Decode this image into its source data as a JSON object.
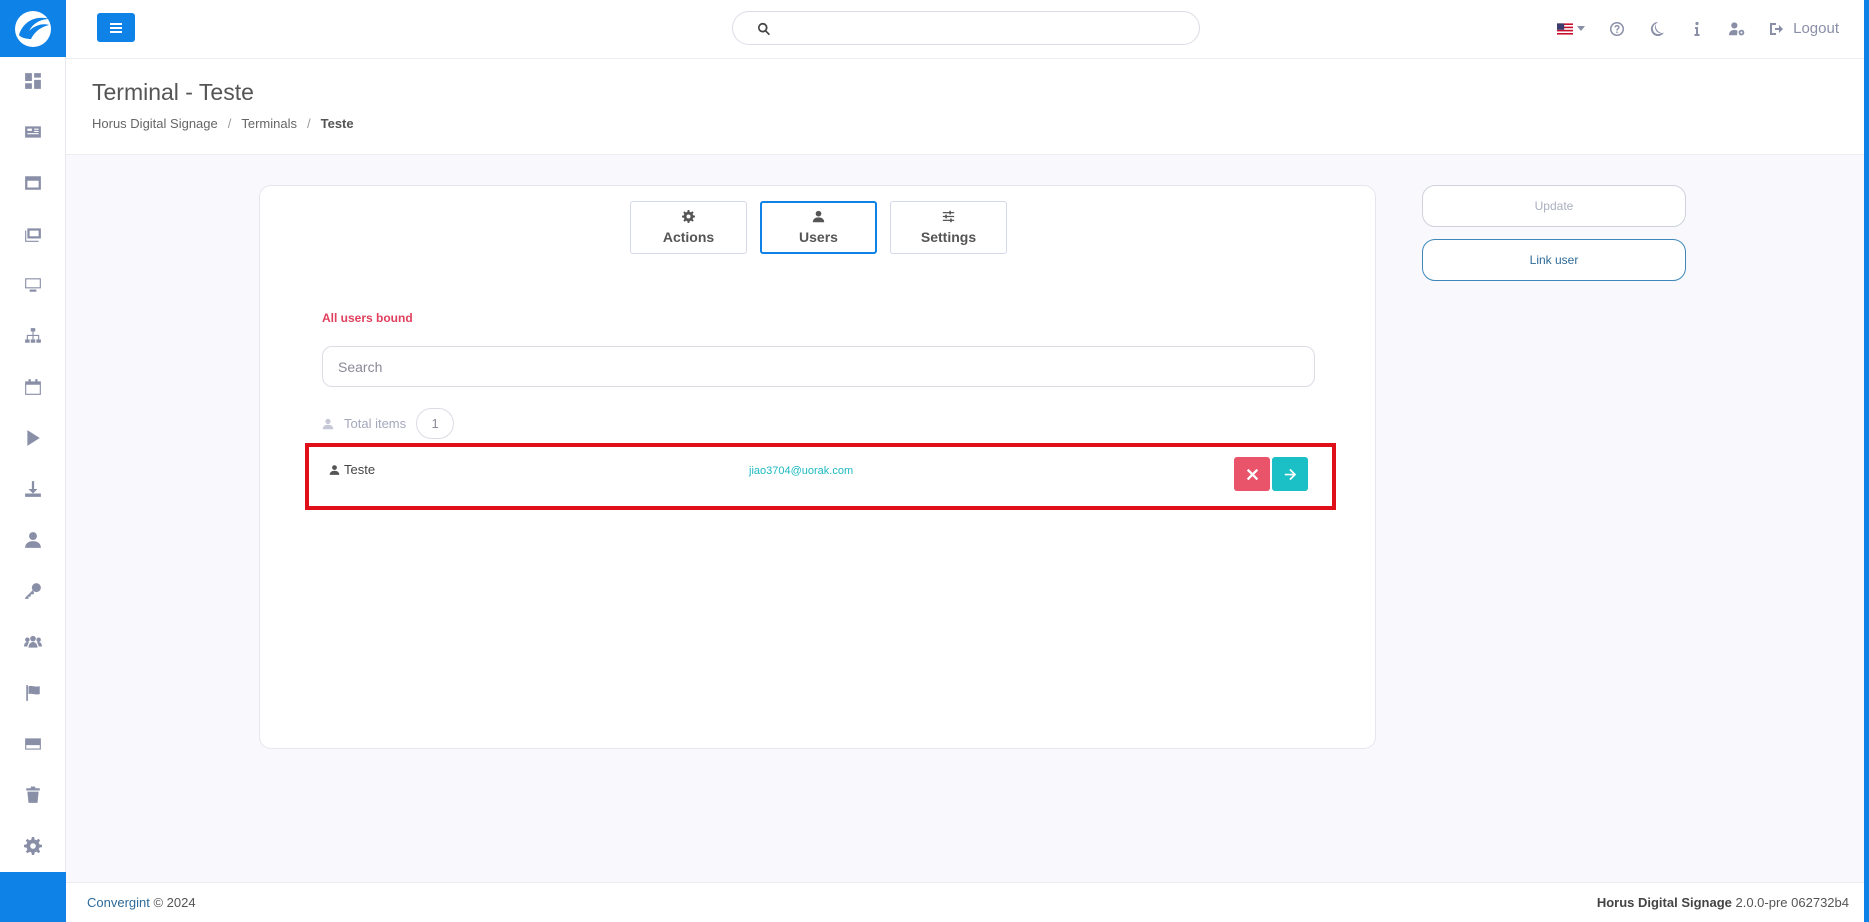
{
  "topbar": {
    "search_placeholder": "",
    "logout_label": "Logout"
  },
  "page": {
    "title": "Terminal - Teste",
    "breadcrumb": [
      "Horus Digital Signage",
      "Terminals",
      "Teste"
    ]
  },
  "tabs": [
    {
      "label": "Actions",
      "icon": "gear-icon"
    },
    {
      "label": "Users",
      "icon": "user-icon",
      "active": true
    },
    {
      "label": "Settings",
      "icon": "sliders-icon"
    }
  ],
  "users": {
    "notice": "All users bound",
    "search_placeholder": "Search",
    "total_label": "Total items",
    "total_count": "1",
    "rows": [
      {
        "name": "Teste",
        "email": "jiao3704@uorak.com"
      }
    ]
  },
  "side_actions": {
    "update_label": "Update",
    "link_user_label": "Link user"
  },
  "footer": {
    "brand": "Convergint",
    "copyright": " © 2024",
    "product": "Horus Digital Signage",
    "version": " 2.0.0-pre 062732b4"
  },
  "colors": {
    "primary": "#0e82e6",
    "danger": "#e9546b",
    "info": "#1bbfc6",
    "highlight": "#e0101a"
  }
}
